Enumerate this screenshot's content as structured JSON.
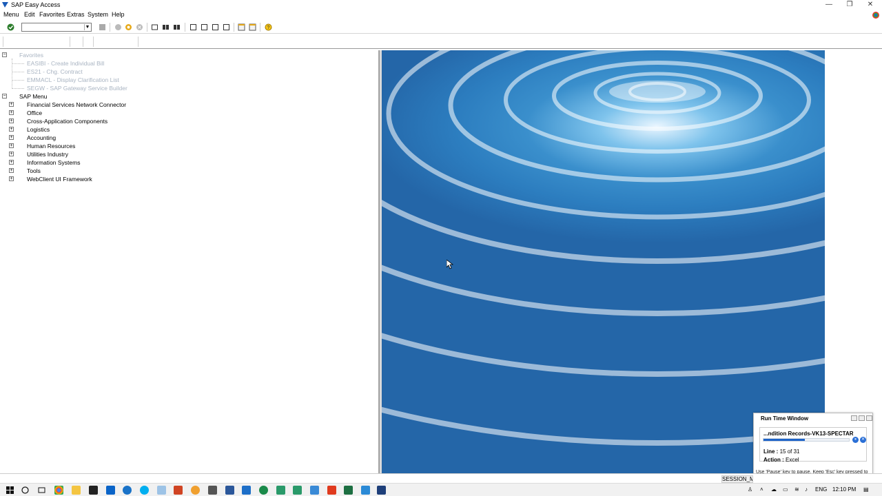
{
  "window": {
    "title": "SAP Easy Access",
    "controls": [
      "—",
      "❐",
      "✕"
    ]
  },
  "menubar": {
    "items": [
      "Menu",
      "Edit",
      "Favorites",
      "Extras",
      "System",
      "Help"
    ]
  },
  "toolbar": {
    "command_field_value": ""
  },
  "tree": {
    "favorites": {
      "label": "Favorites",
      "items": [
        "EASIBI - Create Individual Bill",
        "ES21 - Chg. Contract",
        "EMMACL - Display Clarification List",
        "SEGW - SAP Gateway Service Builder"
      ]
    },
    "sap_menu": {
      "label": "SAP Menu",
      "items": [
        "Financial Services Network Connector",
        "Office",
        "Cross-Application Components",
        "Logistics",
        "Accounting",
        "Human Resources",
        "Utilities Industry",
        "Information Systems",
        "Tools",
        "WebClient UI Framework"
      ]
    }
  },
  "run_time_window": {
    "title": "Run Time Window",
    "script_name": "...ndition Records-VK13-SPECTAR",
    "progress": 0.48,
    "line_label": "Line :",
    "line_value": "15 of 31",
    "action_label": "Action :",
    "action_value": "Excel",
    "hint": "Use 'Pause' key to pause. Keep 'Esc' key pressed to abort."
  },
  "statusbar": {
    "session": "SESSION_M"
  },
  "taskbar": {
    "lang": "ENG",
    "time": "12:10 PM"
  },
  "colors": {
    "accent": "#1e64c8",
    "favorites_text": "#a9b4c2",
    "image_blue": "#2c7dbf"
  }
}
